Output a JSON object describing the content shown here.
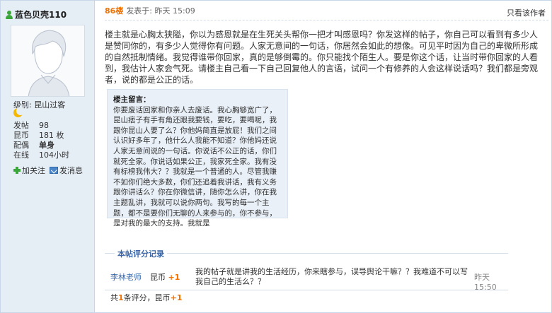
{
  "user": {
    "name": "蓝色贝壳110",
    "level": "级别: 昆山过客",
    "stats": [
      {
        "key": "发帖",
        "value": "98"
      },
      {
        "key": "昆币",
        "value": "181 枚"
      },
      {
        "key": "配偶",
        "value": "单身"
      },
      {
        "key": "在线",
        "value": "104小时"
      }
    ],
    "follow_label": "加关注",
    "message_label": "发消息"
  },
  "post": {
    "floor": "86楼",
    "posted": "发表于: 昨天 15:09",
    "only_author": "只看该作者",
    "body": "楼主就是心胸太狭隘，你以为感恩就是在生死关头帮你一把才叫感恩吗？你发这样的帖子，你自己可以看到有多少人是赞同你的，有多少人觉得你有问题。人家无意间的一句话，你居然会如此的想像。可见平时因为自己的卑微所形成的自然抵制情绪。我觉得谁带你回家，真的是够倒霉的。你只能找个陌生人。要是你这个话，让当时带你回家的人看到，我估计人家会气死。请楼主自己看一下自己回复他人的言语，试问一个有修养的人会这样说话吗？我们都是旁观者，说的都是公正的话。",
    "quote": {
      "title": "楼主留言：",
      "text": "你要废话回家和你亲人去废话。我心胸够宽广了，昆山痞子有手有角还跟我要钱，要吃，要喝呢，我跟你昆山人要了么？你他妈简直是放屁！我们之间认识好多年了，他什么人我能不知道？你他妈还说人家无意间说的一句话。你说话不公正的话，你们就死全家。你说话如果公正，我家死全家。我有没有标榜我伟大？？我就是一个普通的人。尽管我赚不如你们绝大多数，你们还追着我讲话，我有义务跟你讲话么？你在你微信讲，随你怎么讲，你在我主题乱讲，我就可以说你两句。我写的每一个主题，都不是要你们无聊的人来参与的，你不参与，是对我的最大的支持。我就是"
    }
  },
  "rating": {
    "title": "本帖评分记录",
    "rows": [
      {
        "user": "李林老师",
        "type": "昆币",
        "amount": "+1",
        "reason": "我的帖子就是讲我的生活经历，你来瞎参与，误导舆论干嘛？？我难道不可以写我自己的生活么？？",
        "time": "昨天 15:50"
      }
    ],
    "total_prefix": "共",
    "total_count": "1",
    "total_mid": "条评分，昆币",
    "total_amount": "+1"
  },
  "colors": {
    "accent_orange": "#f07000",
    "link_blue": "#3a66a8",
    "sidebar_bg": "#e5edf5",
    "quote_bg": "#e9f0f8"
  }
}
